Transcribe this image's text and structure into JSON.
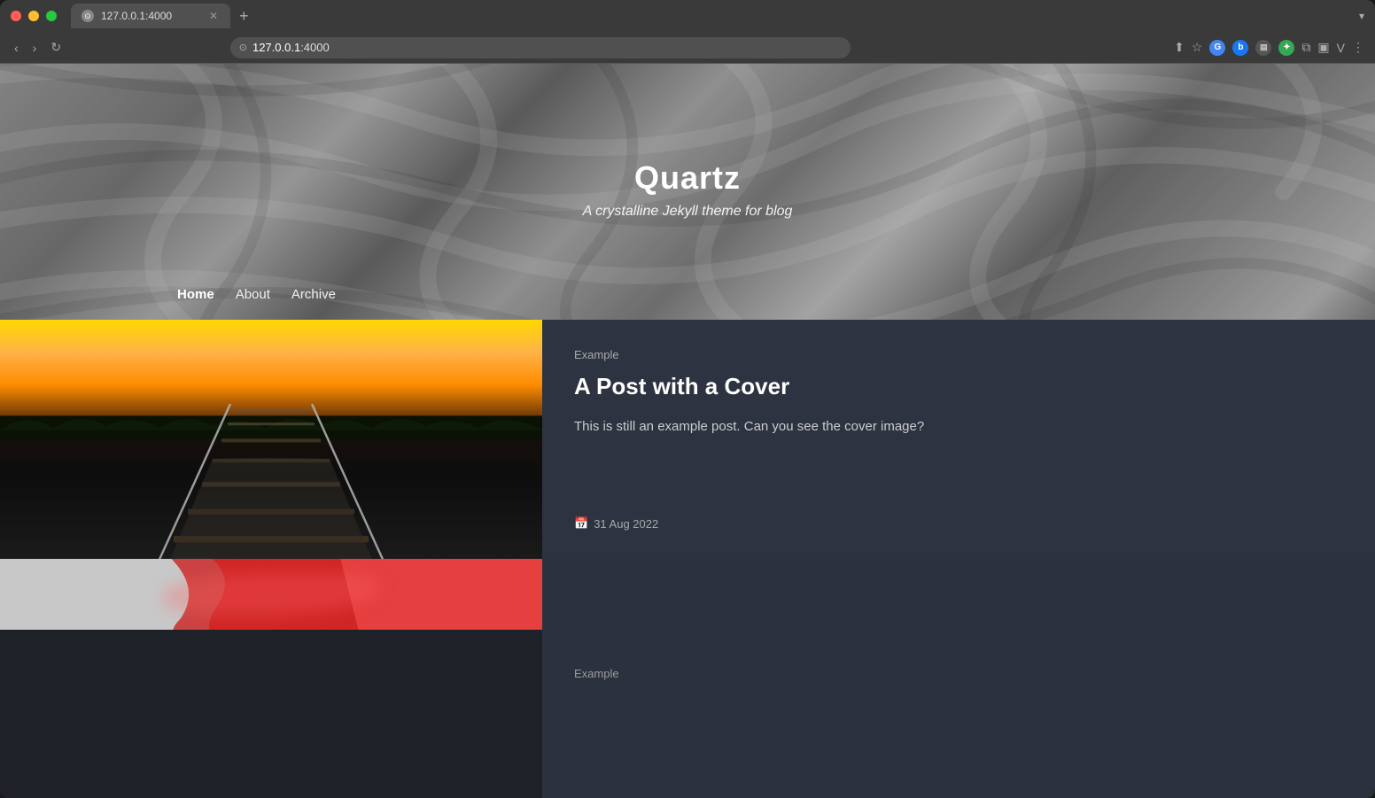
{
  "browser": {
    "tab_title": "127.0.0.1:4000",
    "url_display": "127.0.0.1",
    "url_port": ":4000",
    "new_tab_label": "+",
    "chevron_label": "▾",
    "back_label": "‹",
    "forward_label": "›",
    "refresh_label": "↻"
  },
  "site": {
    "title": "Quartz",
    "subtitle": "A crystalline Jekyll theme for blog",
    "nav": [
      {
        "label": "Home",
        "active": true
      },
      {
        "label": "About",
        "active": false
      },
      {
        "label": "Archive",
        "active": false
      }
    ]
  },
  "posts": [
    {
      "category": "Example",
      "title": "A Post with a Cover",
      "excerpt": "This is still an example post. Can you see the cover image?",
      "date": "31 Aug 2022"
    },
    {
      "category": "Example",
      "title": "",
      "excerpt": "",
      "date": ""
    }
  ]
}
